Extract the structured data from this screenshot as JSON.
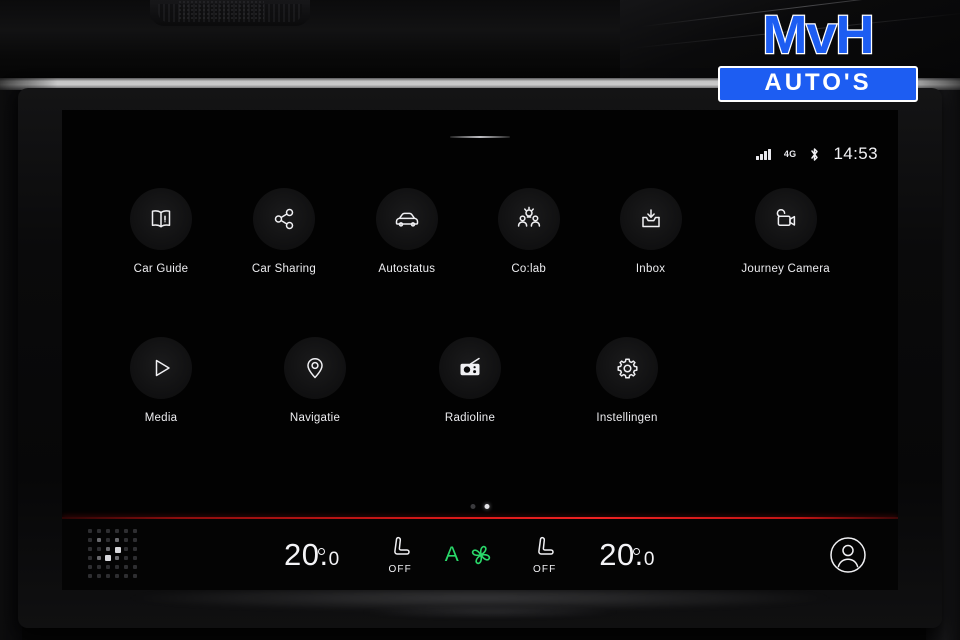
{
  "watermark": {
    "brand": "MvH",
    "sub": "AUTO'S",
    "blue": "#1d5df2"
  },
  "statusbar": {
    "signal_icon": "signal-bars-icon",
    "network": "4G",
    "bluetooth_icon": "bluetooth-icon",
    "time": "14:53"
  },
  "home": {
    "drag_handle": "pull-down-handle",
    "rows": [
      [
        {
          "label": "Car Guide",
          "icon": "book-icon"
        },
        {
          "label": "Car Sharing",
          "icon": "share-icon"
        },
        {
          "label": "Autostatus",
          "icon": "car-icon"
        },
        {
          "label": "Co:lab",
          "icon": "people-idea-icon"
        },
        {
          "label": "Inbox",
          "icon": "inbox-download-icon"
        },
        {
          "label": "Journey Camera",
          "icon": "video-camera-icon"
        }
      ],
      [
        {
          "label": "Media",
          "icon": "play-icon"
        },
        {
          "label": "Navigatie",
          "icon": "map-pin-icon"
        },
        {
          "label": "Radioline",
          "icon": "radio-icon"
        },
        {
          "label": "Instellingen",
          "icon": "gear-icon"
        }
      ]
    ],
    "pager": {
      "total": 2,
      "active": 2
    }
  },
  "climate": {
    "divider_color": "#e02020",
    "app_grid_icon": "app-grid-icon",
    "left_temp": {
      "whole": "20.",
      "decimal": "0",
      "unit": "°"
    },
    "left_seat": {
      "icon": "seat-heater-icon",
      "state": "OFF"
    },
    "auto_fan": {
      "label": "A",
      "icon": "fan-icon",
      "color": "#2ad96a"
    },
    "right_seat": {
      "icon": "seat-heater-icon",
      "state": "OFF"
    },
    "right_temp": {
      "whole": "20.",
      "decimal": "0",
      "unit": "°"
    },
    "profile_icon": "user-profile-icon"
  }
}
